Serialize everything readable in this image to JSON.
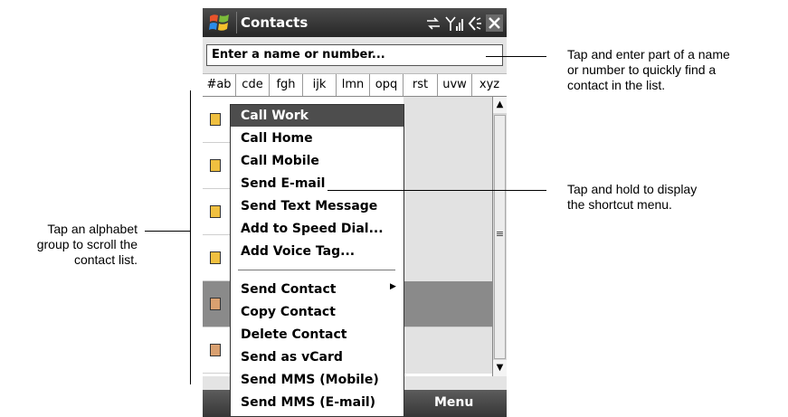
{
  "window": {
    "title": "Contacts"
  },
  "search": {
    "placeholder": "Enter a name or number..."
  },
  "alphabet_groups": [
    "#ab",
    "cde",
    "fgh",
    "ijk",
    "lmn",
    "opq",
    "rst",
    "uvw",
    "xyz"
  ],
  "context_menu": {
    "items": [
      "Call Work",
      "Call Home",
      "Call Mobile",
      "Send E-mail",
      "Send Text Message",
      "Add to Speed Dial...",
      "Add Voice Tag...",
      "Send Contact",
      "Copy Contact",
      "Delete Contact",
      "Send as vCard",
      "Send MMS (Mobile)",
      "Send MMS (E-mail)"
    ]
  },
  "softkeys": {
    "right": "Menu"
  },
  "annotations": {
    "search_callout": [
      "Tap and enter part of a name",
      "or number to quickly find a",
      "contact in the list."
    ],
    "menu_callout": [
      "Tap and hold to display",
      "the shortcut menu."
    ],
    "alphabet_callout": [
      "Tap an alphabet",
      "group to scroll the",
      "contact list."
    ]
  },
  "icons": [
    "windows-start-icon",
    "sync-icon",
    "signal-icon",
    "volume-icon",
    "close-icon"
  ],
  "colors": {
    "titlebar": "#333333",
    "highlight": "#4d4d4d",
    "selected_row": "#8a8a8a"
  }
}
